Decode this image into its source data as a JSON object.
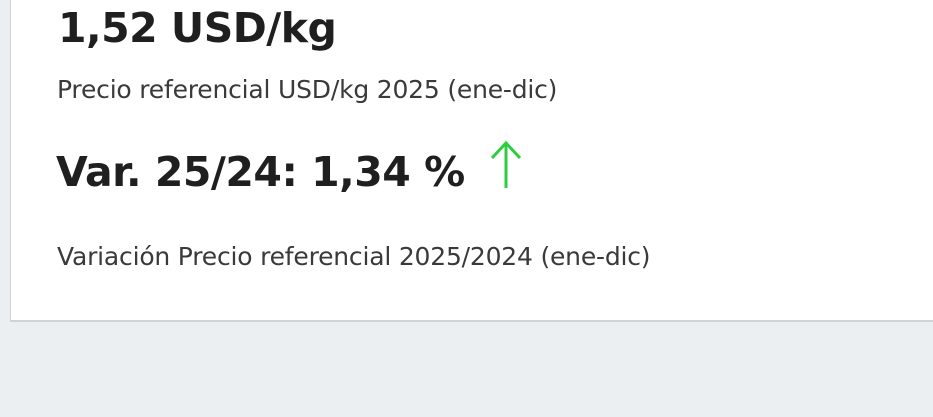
{
  "price": {
    "value": "1,52 USD/kg",
    "description": "Precio referencial USD/kg 2025 (ene-dic)"
  },
  "variation": {
    "value": "Var. 25/24: 1,34 %",
    "description": "Variación Precio referencial 2025/2024 (ene-dic)",
    "trend_icon": "arrow-up-icon",
    "trend_color": "#2ecc40"
  }
}
